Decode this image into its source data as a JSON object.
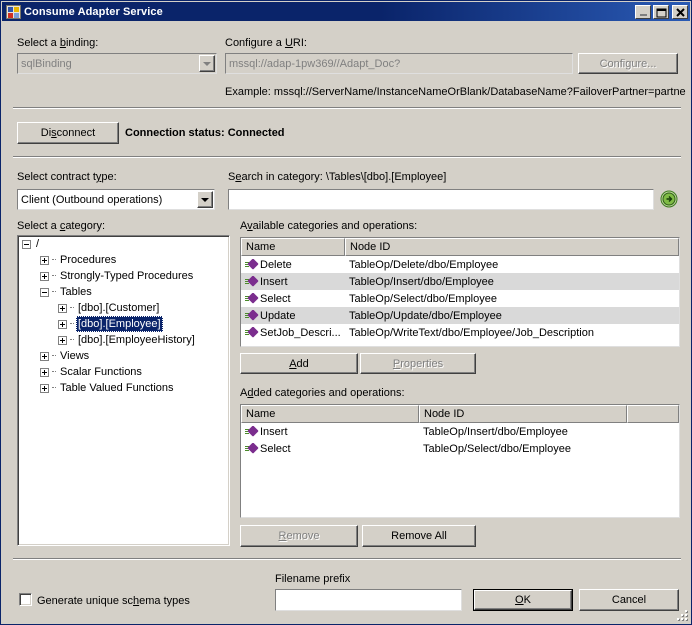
{
  "window": {
    "title": "Consume Adapter Service",
    "icon": "app-icon",
    "controls": {
      "minimize": "minimize-icon",
      "maximize": "maximize-icon",
      "close": "close-icon"
    }
  },
  "binding": {
    "label_pre": "Select a ",
    "label_accel": "b",
    "label_post": "inding:",
    "value": "sqlBinding",
    "enabled": false
  },
  "uri": {
    "label_pre": "Configure a ",
    "label_accel": "U",
    "label_post": "RI:",
    "value": "mssql://adap-1pw369//Adapt_Doc?",
    "enabled": false,
    "configure_button": "Configure...",
    "configure_enabled": false,
    "example": "Example: mssql://ServerName/InstanceNameOrBlank/DatabaseName?FailoverPartner=partne"
  },
  "connection": {
    "disconnect_pre": "Di",
    "disconnect_accel": "s",
    "disconnect_post": "connect",
    "status_label": "Connection status:",
    "status_value": "Connected"
  },
  "contract": {
    "label_pre": "Select contract t",
    "label_accel": "y",
    "label_post": "pe:",
    "value": "Client (Outbound operations)"
  },
  "search": {
    "label_pre": "S",
    "label_accel": "e",
    "label_post": "arch in category: \\Tables\\[dbo].[Employee]",
    "value": "",
    "go_icon": "go-arrow-icon"
  },
  "category": {
    "label_pre": "Select a ",
    "label_accel": "c",
    "label_post": "ategory:",
    "tree": [
      {
        "label": "/",
        "depth": 0,
        "state": "minus",
        "selected": false
      },
      {
        "label": "Procedures",
        "depth": 1,
        "state": "plus",
        "selected": false
      },
      {
        "label": "Strongly-Typed Procedures",
        "depth": 1,
        "state": "plus",
        "selected": false
      },
      {
        "label": "Tables",
        "depth": 1,
        "state": "minus",
        "selected": false
      },
      {
        "label": "[dbo].[Customer]",
        "depth": 2,
        "state": "plus",
        "selected": false
      },
      {
        "label": "[dbo].[Employee]",
        "depth": 2,
        "state": "plus",
        "selected": true
      },
      {
        "label": "[dbo].[EmployeeHistory]",
        "depth": 2,
        "state": "plus",
        "selected": false
      },
      {
        "label": "Views",
        "depth": 1,
        "state": "plus",
        "selected": false
      },
      {
        "label": "Scalar Functions",
        "depth": 1,
        "state": "plus",
        "selected": false
      },
      {
        "label": "Table Valued Functions",
        "depth": 1,
        "state": "plus",
        "selected": false
      }
    ]
  },
  "available": {
    "label_pre": "A",
    "label_accel": "v",
    "label_post": "ailable categories and operations:",
    "columns": [
      "Name",
      "Node ID"
    ],
    "rows": [
      {
        "name": "Delete",
        "node_id": "TableOp/Delete/dbo/Employee"
      },
      {
        "name": "Insert",
        "node_id": "TableOp/Insert/dbo/Employee"
      },
      {
        "name": "Select",
        "node_id": "TableOp/Select/dbo/Employee"
      },
      {
        "name": "Update",
        "node_id": "TableOp/Update/dbo/Employee"
      },
      {
        "name": "SetJob_Descri...",
        "node_id": "TableOp/WriteText/dbo/Employee/Job_Description"
      }
    ]
  },
  "add_row": {
    "add_pre": "",
    "add_accel": "A",
    "add_post": "dd",
    "properties_pre": "",
    "properties_accel": "P",
    "properties_post": "roperties",
    "properties_enabled": false
  },
  "added": {
    "label_pre": "A",
    "label_accel": "d",
    "label_post": "ded categories and operations:",
    "columns": [
      "Name",
      "Node ID",
      ""
    ],
    "rows": [
      {
        "name": "Insert",
        "node_id": "TableOp/Insert/dbo/Employee"
      },
      {
        "name": "Select",
        "node_id": "TableOp/Select/dbo/Employee"
      }
    ]
  },
  "remove_row": {
    "remove_pre": "",
    "remove_accel": "R",
    "remove_post": "emove",
    "remove_enabled": false,
    "remove_all": "Remove All"
  },
  "footer": {
    "checkbox_pre": "Generate unique sc",
    "checkbox_accel": "h",
    "checkbox_post": "ema types",
    "checkbox_checked": false,
    "filename_label": "Filename prefix",
    "filename_value": "",
    "ok_pre": "",
    "ok_accel": "O",
    "ok_post": "K",
    "cancel": "Cancel"
  },
  "colors": {
    "face": "#d4d0c8",
    "title_active": "#0a246a",
    "selection": "#0a246a",
    "op_icon": "#7b2d8e",
    "go_green": "#4a9a28",
    "alt_row": "#d9d9d9"
  }
}
